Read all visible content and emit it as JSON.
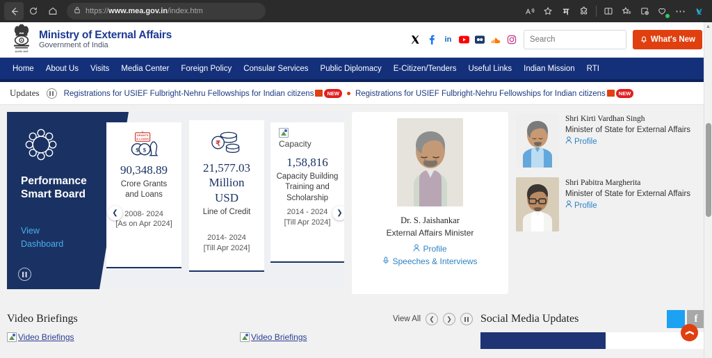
{
  "browser": {
    "url_prefix": "https://",
    "url_domain": "www.mea.gov.in",
    "url_path": "/index.htm",
    "back_icon": "back-arrow-icon",
    "reload_icon": "reload-icon",
    "home_icon": "home-icon",
    "lock_icon": "lock-icon",
    "toolbar_icons": [
      {
        "name": "read-aloud-icon",
        "glyph": "Aᴴ"
      },
      {
        "name": "favorite-star-icon",
        "glyph": "☆"
      },
      {
        "name": "hindi-input-icon",
        "glyph": "म"
      },
      {
        "name": "extensions-icon",
        "glyph": "❂"
      },
      {
        "name": "split-screen-icon",
        "glyph": "▭"
      },
      {
        "name": "collections-icon",
        "glyph": "☆"
      },
      {
        "name": "add-tab-icon",
        "glyph": "⊕"
      },
      {
        "name": "browser-essentials-icon",
        "glyph": "♡"
      },
      {
        "name": "more-options-icon",
        "glyph": "⋯"
      },
      {
        "name": "copilot-icon",
        "glyph": "◗"
      }
    ]
  },
  "header": {
    "emblem_name": "national-emblem-icon",
    "title": "Ministry of External Affairs",
    "subtitle": "Government of India",
    "social": [
      {
        "name": "x-twitter-icon",
        "glyph": "𝕏",
        "color": "#000000"
      },
      {
        "name": "facebook-icon",
        "glyph": "f",
        "color": "#1877F2"
      },
      {
        "name": "linkedin-icon",
        "glyph": "in",
        "color": "#0A66C2"
      },
      {
        "name": "youtube-icon",
        "glyph": "▶",
        "color": "#FF0000"
      },
      {
        "name": "flickr-icon",
        "glyph": "••",
        "color": "#0063DC"
      },
      {
        "name": "soundcloud-icon",
        "glyph": "☁",
        "color": "#FF7700"
      },
      {
        "name": "instagram-icon",
        "glyph": "▢",
        "color": "#C13584"
      }
    ],
    "search_placeholder": "Search",
    "search_value": "",
    "search_icon": "search-icon",
    "whats_new_label": "What's New",
    "whats_new_icon": "bell-icon",
    "whats_new_color": "#e0400f"
  },
  "nav": {
    "items": [
      "Home",
      "About Us",
      "Visits",
      "Media Center",
      "Foreign Policy",
      "Consular Services",
      "Public Diplomacy",
      "E-Citizen/Tenders",
      "Useful Links",
      "Indian Mission",
      "RTI"
    ],
    "bg_color": "#14307a"
  },
  "ticker": {
    "label": "Updates",
    "pause_icon": "pause-icon",
    "messages": [
      "Registrations for USIEF Fulbright-Nehru Fellowships for Indian citizens",
      "Registrations for USIEF Fulbright-Nehru Fellowships for Indian citizens"
    ],
    "badge": "NEW",
    "pdf_icon": "pdf-icon"
  },
  "smart_board": {
    "logo_icon": "smart-board-logo-icon",
    "title_line1": "Performance",
    "title_line2": "Smart Board",
    "view_link_line1": "View",
    "view_link_line2": "Dashboard",
    "pause_icon": "pause-icon",
    "prev_icon": "chevron-left-icon",
    "next_icon": "chevron-right-icon",
    "bg_color": "#1a3263",
    "cards": [
      {
        "icon": "grants-and-loans-icon",
        "icon_alt": "",
        "value": "90,348.89",
        "label": "Crore Grants\nand Loans",
        "period": "2008- 2024\n[As on Apr 2024]"
      },
      {
        "icon": "line-of-credit-coins-icon",
        "icon_alt": "",
        "value": "21,577.03\nMillion\nUSD",
        "label": "Line of Credit",
        "period": "2014- 2024\n[Till Apr 2024]"
      },
      {
        "icon": "broken-image-icon",
        "icon_alt": "Capacity",
        "value": "1,58,816",
        "label": "Capacity Building Training and Scholarship",
        "period": "2014 - 2024\n[Till Apr 2024]"
      }
    ]
  },
  "eam": {
    "photo_alt": "portrait-photo",
    "name": "Dr. S. Jaishankar",
    "role": "External Affairs Minister",
    "profile_label": "Profile",
    "profile_icon": "person-icon",
    "speeches_label": "Speeches & Interviews",
    "speeches_icon": "microphone-icon"
  },
  "ministers_of_state": [
    {
      "photo_alt": "portrait-photo",
      "name": "Shri Kirti Vardhan Singh",
      "role": "Minister of State for External Affairs",
      "profile_label": "Profile",
      "profile_icon": "person-icon"
    },
    {
      "photo_alt": "portrait-photo",
      "name": "Shri Pabitra Margherita",
      "role": "Minister of State for External Affairs",
      "profile_label": "Profile",
      "profile_icon": "person-icon"
    }
  ],
  "video_section": {
    "title": "Video Briefings",
    "view_all_label": "View All",
    "prev_icon": "chevron-left-icon",
    "next_icon": "chevron-right-icon",
    "pause_icon": "pause-icon",
    "thumbnails": [
      {
        "alt": "Video Briefings",
        "icon": "broken-image-icon"
      },
      {
        "alt": "Video Briefings",
        "icon": "broken-image-icon"
      }
    ]
  },
  "social_section": {
    "title": "Social Media Updates",
    "tiles": [
      {
        "name": "twitter-tile",
        "glyph": "",
        "color": "#1da1f2"
      },
      {
        "name": "facebook-tile",
        "glyph": "f",
        "color": "#a8a8a8"
      }
    ],
    "scroll_top_icon": "chevron-up-icon",
    "scroll_top_color": "#e0400f"
  }
}
